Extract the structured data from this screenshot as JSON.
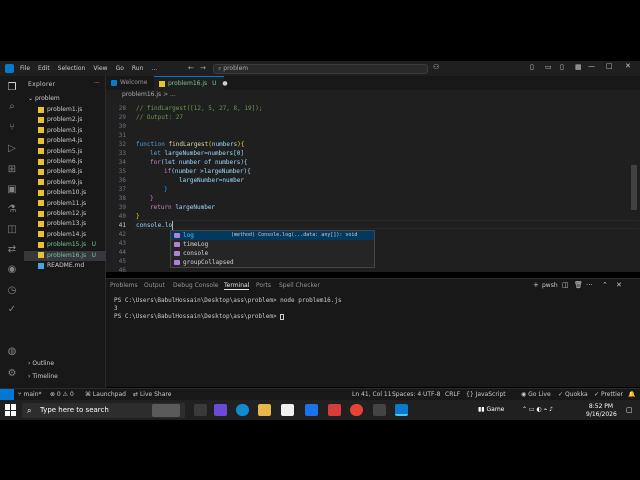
{
  "window": {
    "menu": [
      "File",
      "Edit",
      "Selection",
      "View",
      "Go",
      "Run",
      "..."
    ],
    "search_placeholder": "problem",
    "win_min": "—",
    "win_max": "□",
    "win_close": "✕"
  },
  "sidebar": {
    "title": "Explorer",
    "folder": "problem",
    "files": [
      {
        "name": "problem1.js"
      },
      {
        "name": "problem2.js"
      },
      {
        "name": "problem3.js"
      },
      {
        "name": "problem4.js"
      },
      {
        "name": "problem5.js"
      },
      {
        "name": "problem6.js"
      },
      {
        "name": "problem8.js"
      },
      {
        "name": "problem9.js"
      },
      {
        "name": "problem10.js"
      },
      {
        "name": "problem11.js"
      },
      {
        "name": "problem12.js"
      },
      {
        "name": "problem13.js"
      },
      {
        "name": "problem14.js"
      },
      {
        "name": "problem15.js",
        "badge": "U"
      },
      {
        "name": "problem16.js",
        "badge": "U"
      },
      {
        "name": "README.md"
      }
    ],
    "outline": "Outline",
    "timeline": "Timeline"
  },
  "tabs": {
    "welcome": "Welcome",
    "active": "problem16.js",
    "active_badge": "U"
  },
  "breadcrumbs": "problem16.js > ...",
  "editor": {
    "line_numbers": [
      "28",
      "29",
      "30",
      "31",
      "32",
      "33",
      "34",
      "35",
      "36",
      "37",
      "38",
      "39",
      "40",
      "41",
      "42",
      "43",
      "44",
      "45",
      "46"
    ],
    "lines": {
      "l28": "// findLargest([12, 5, 27, 8, 19]);",
      "l29": "// Output: 27",
      "l32_kw": "function",
      "l32_fn": "findLargest",
      "l32_p": "numbers",
      "l33_kw": "let",
      "l33_rest": "largeNumber=numbers[0]",
      "l34_kw": "for",
      "l34_rest": "(let number of numbers){",
      "l35_kw": "if",
      "l35_rest": "(number >largeNumber){",
      "l36": "largeNumber=number",
      "l37": "}",
      "l38": "}",
      "l39_kw": "return",
      "l39_rest": "largeNumber",
      "l40": "}",
      "l41": "console.lo"
    },
    "suggestions": [
      {
        "label": "log",
        "detail": "(method) Console.log(...data: any[]): void"
      },
      {
        "label": "timeLog",
        "detail": ""
      },
      {
        "label": "console",
        "detail": ""
      },
      {
        "label": "groupCollapsed",
        "detail": ""
      }
    ]
  },
  "panel": {
    "tabs": [
      "Problems",
      "Output",
      "Debug Console",
      "Terminal",
      "Ports",
      "Spell Checker"
    ],
    "active_tab": "Terminal",
    "shell_label": "pwsh",
    "lines": [
      "PS C:\\Users\\BabulHossain\\Desktop\\ass\\problem> node problem16.js",
      "3",
      "PS C:\\Users\\BabulHossain\\Desktop\\ass\\problem> "
    ]
  },
  "statusbar": {
    "branch": "main*",
    "errors": "⊗ 0 ⚠ 0",
    "launchpad": "Launchpad",
    "liveshare": "Live Share",
    "position": "Ln 41, Col 11",
    "spaces": "Spaces: 4",
    "encoding": "UTF-8",
    "eol": "CRLF",
    "language": "JavaScript",
    "golive": "Go Live",
    "quokka": "Quokka",
    "prettier": "Prettier"
  },
  "taskbar": {
    "search_placeholder": "Type here to search",
    "game": "Game",
    "time": "8:52 PM",
    "date": "9/16/2026"
  },
  "colors": {
    "accent": "#0078d4",
    "editor_bg": "#1f1f1f",
    "untracked": "#73c991"
  }
}
